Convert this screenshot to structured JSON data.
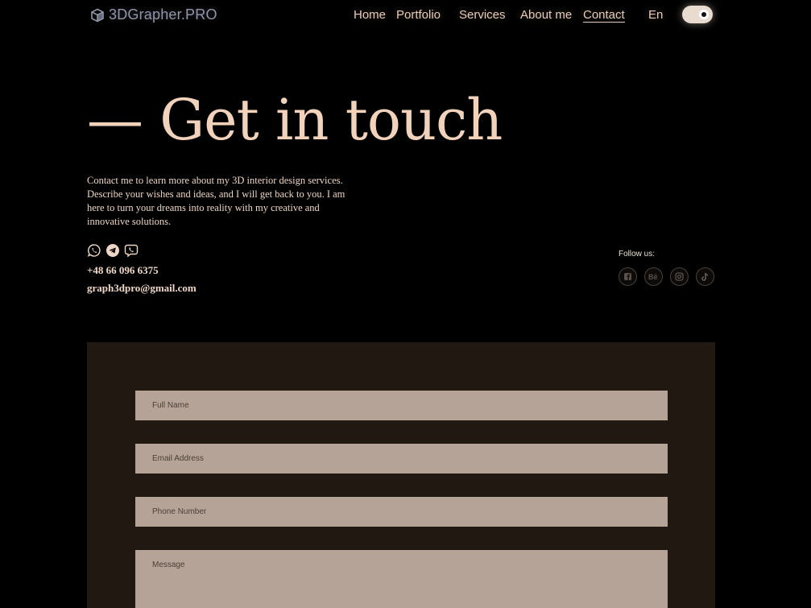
{
  "header": {
    "logo_text": "3DGrapher.PRO",
    "nav": [
      {
        "label": "Home"
      },
      {
        "label": "Portfolio"
      },
      {
        "label": "Services"
      },
      {
        "label": "About me"
      },
      {
        "label": "Contact",
        "active": true
      }
    ],
    "language": "En",
    "theme_toggle": {
      "on": true
    }
  },
  "hero": {
    "title": "— Get in touch",
    "intro": "Contact me to learn more about my 3D interior design services. Describe your wishes and ideas, and I will get back to you. I am here to turn your dreams into reality with my creative and innovative solutions."
  },
  "contact": {
    "messengers": [
      "whatsapp-icon",
      "telegram-icon",
      "viber-icon"
    ],
    "phone": "+48 66 096 6375",
    "email": "graph3dpro@gmail.com"
  },
  "social": {
    "label": "Follow us:",
    "icons": [
      "facebook-icon",
      "behance-icon",
      "instagram-icon",
      "tiktok-icon"
    ]
  },
  "form": {
    "full_name_placeholder": "Full Name",
    "email_placeholder": "Email Address",
    "phone_placeholder": "Phone Number",
    "message_placeholder": "Message"
  },
  "colors": {
    "background": "#000000",
    "accent_text": "#f2d2ba",
    "form_panel": "#201811",
    "input_fill": "#b6a397"
  }
}
